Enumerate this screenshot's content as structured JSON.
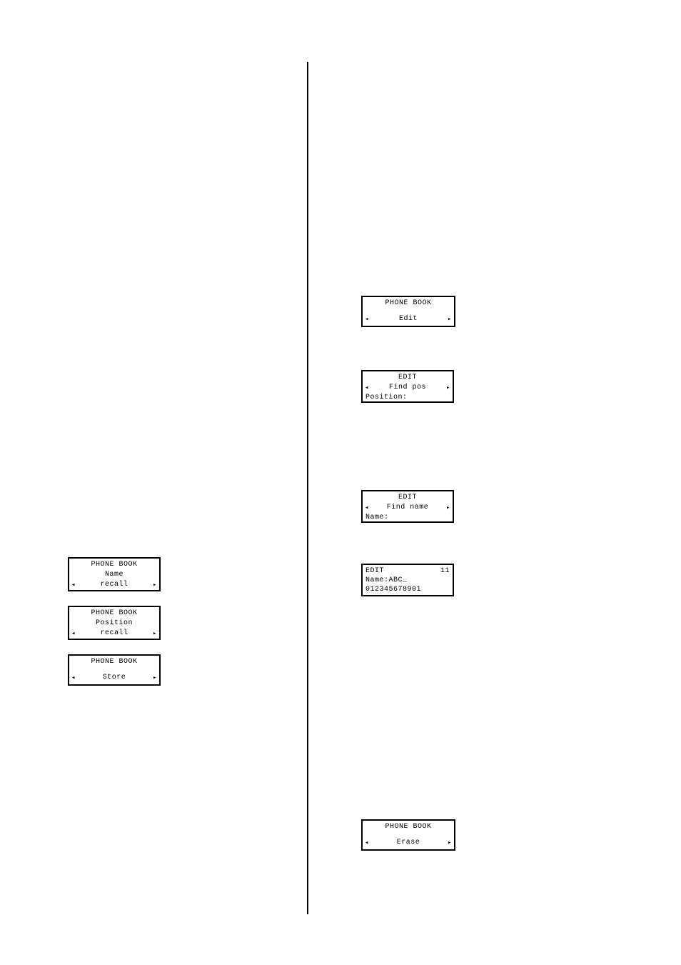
{
  "left": {
    "lcd1": {
      "title": "PHONE BOOK",
      "line2": "Name",
      "line3": "recall"
    },
    "lcd2": {
      "title": "PHONE BOOK",
      "line2": "Position",
      "line3": "recall"
    },
    "lcd3": {
      "title": "PHONE BOOK",
      "line2": "Store"
    }
  },
  "right": {
    "lcd4": {
      "title": "PHONE BOOK",
      "line2": "Edit"
    },
    "lcd5": {
      "title": "EDIT",
      "line2": "Find pos",
      "line3": "Position:"
    },
    "lcd6": {
      "title": "EDIT",
      "line2": "Find name",
      "line3": "Name:"
    },
    "lcd7": {
      "left": "EDIT",
      "right": "11",
      "line2": "Name:ABC_",
      "line3": "012345678901"
    },
    "lcd8": {
      "title": "PHONE BOOK",
      "line2": "Erase"
    }
  },
  "arrows": {
    "left": "◂",
    "right": "▸"
  }
}
